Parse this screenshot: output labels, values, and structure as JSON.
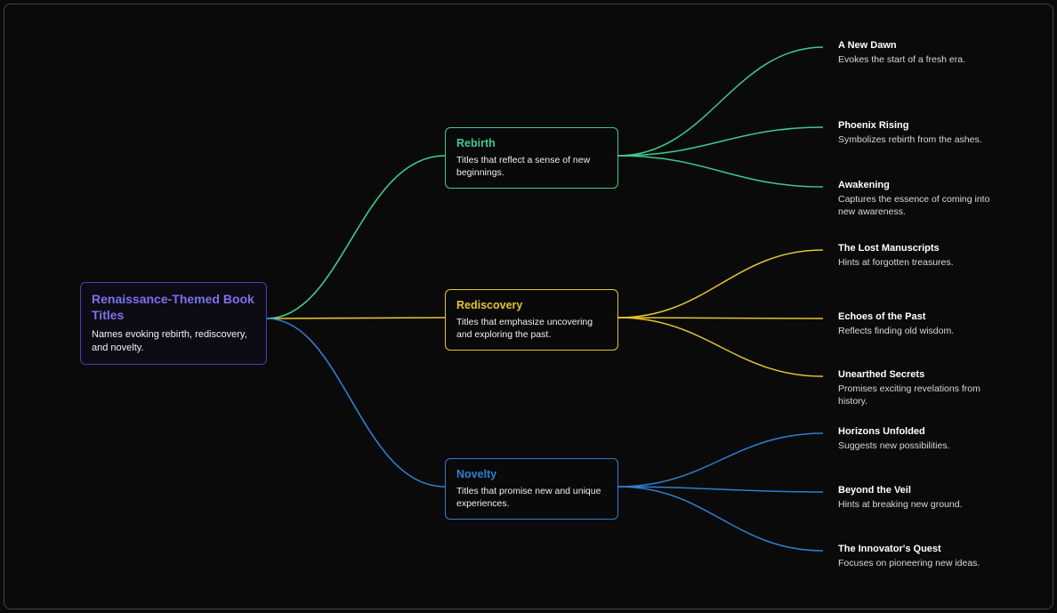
{
  "root": {
    "title": "Renaissance-Themed Book Titles",
    "desc": "Names evoking rebirth, rediscovery, and novelty.",
    "color": "#7b72e8"
  },
  "branches": [
    {
      "key": "rebirth",
      "title": "Rebirth",
      "desc": "Titles that reflect a sense of new beginnings.",
      "color": "#3fc98e",
      "leaves": [
        {
          "title": "A New Dawn",
          "desc": "Evokes the start of a fresh era."
        },
        {
          "title": "Phoenix Rising",
          "desc": "Symbolizes rebirth from the ashes."
        },
        {
          "title": "Awakening",
          "desc": "Captures the essence of coming into new awareness."
        }
      ]
    },
    {
      "key": "rediscovery",
      "title": "Rediscovery",
      "desc": "Titles that emphasize uncovering and exploring the past.",
      "color": "#e4c330",
      "leaves": [
        {
          "title": "The Lost Manuscripts",
          "desc": "Hints at forgotten treasures."
        },
        {
          "title": "Echoes of the Past",
          "desc": "Reflects finding old wisdom."
        },
        {
          "title": "Unearthed Secrets",
          "desc": "Promises exciting revelations from history."
        }
      ]
    },
    {
      "key": "novelty",
      "title": "Novelty",
      "desc": "Titles that promise new and unique experiences.",
      "color": "#2e7fd1",
      "leaves": [
        {
          "title": "Horizons Unfolded",
          "desc": "Suggests new possibilities."
        },
        {
          "title": "Beyond the Veil",
          "desc": "Hints at breaking new ground."
        },
        {
          "title": "The Innovator's Quest",
          "desc": "Focuses on pioneering new ideas."
        }
      ]
    }
  ]
}
